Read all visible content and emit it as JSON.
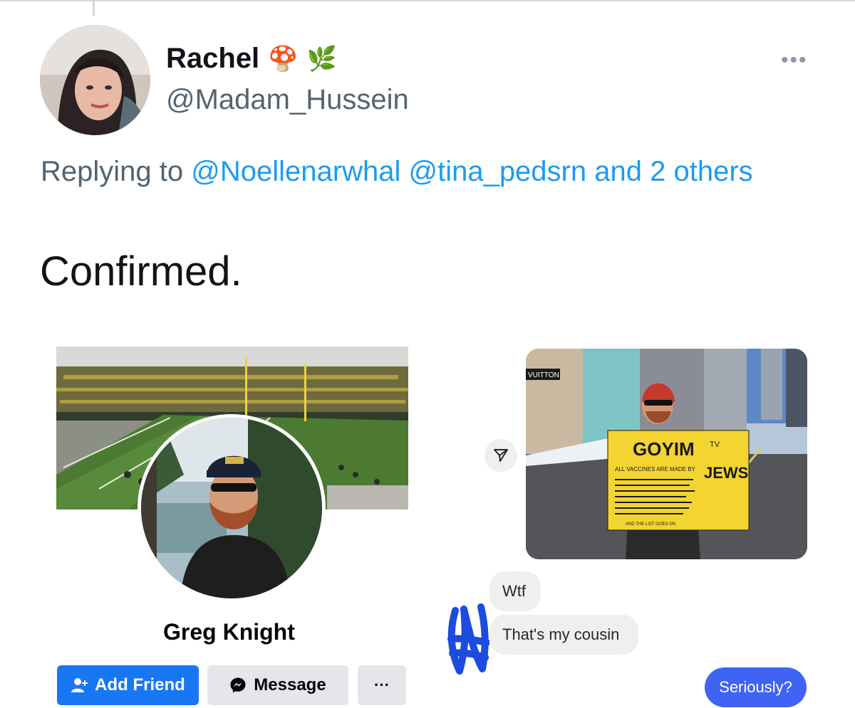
{
  "tweet": {
    "display_name": "Rachel",
    "emojis": [
      "🍄",
      "🌿"
    ],
    "handle": "@Madam_Hussein",
    "reply_prefix": "Replying to",
    "reply_mentions": [
      "@Noellenarwhal",
      "@tina_pedsrn"
    ],
    "reply_suffix": "and 2 others",
    "text": "Confirmed.",
    "more_icon": "ellipsis-icon"
  },
  "facebook_profile": {
    "name": "Greg Knight",
    "add_friend_label": "Add Friend",
    "message_label": "Message",
    "more_label": "···"
  },
  "dm": {
    "sign": {
      "headline": "GOYIM",
      "headline_suffix": "TV",
      "line1": "ALL VACCINES ARE MADE BY",
      "word": "JEWS",
      "side_text": "AS ARE ALL THE LIES YOU HEAR ON MAINSTREAM MEDIA",
      "footer": "AND THE LIST GOES ON"
    },
    "store_sign": "VUITTON",
    "messages": [
      {
        "text": "Wtf",
        "from": "other"
      },
      {
        "text": "That's my cousin",
        "from": "other"
      },
      {
        "text": "Seriously?",
        "from": "me"
      }
    ]
  }
}
